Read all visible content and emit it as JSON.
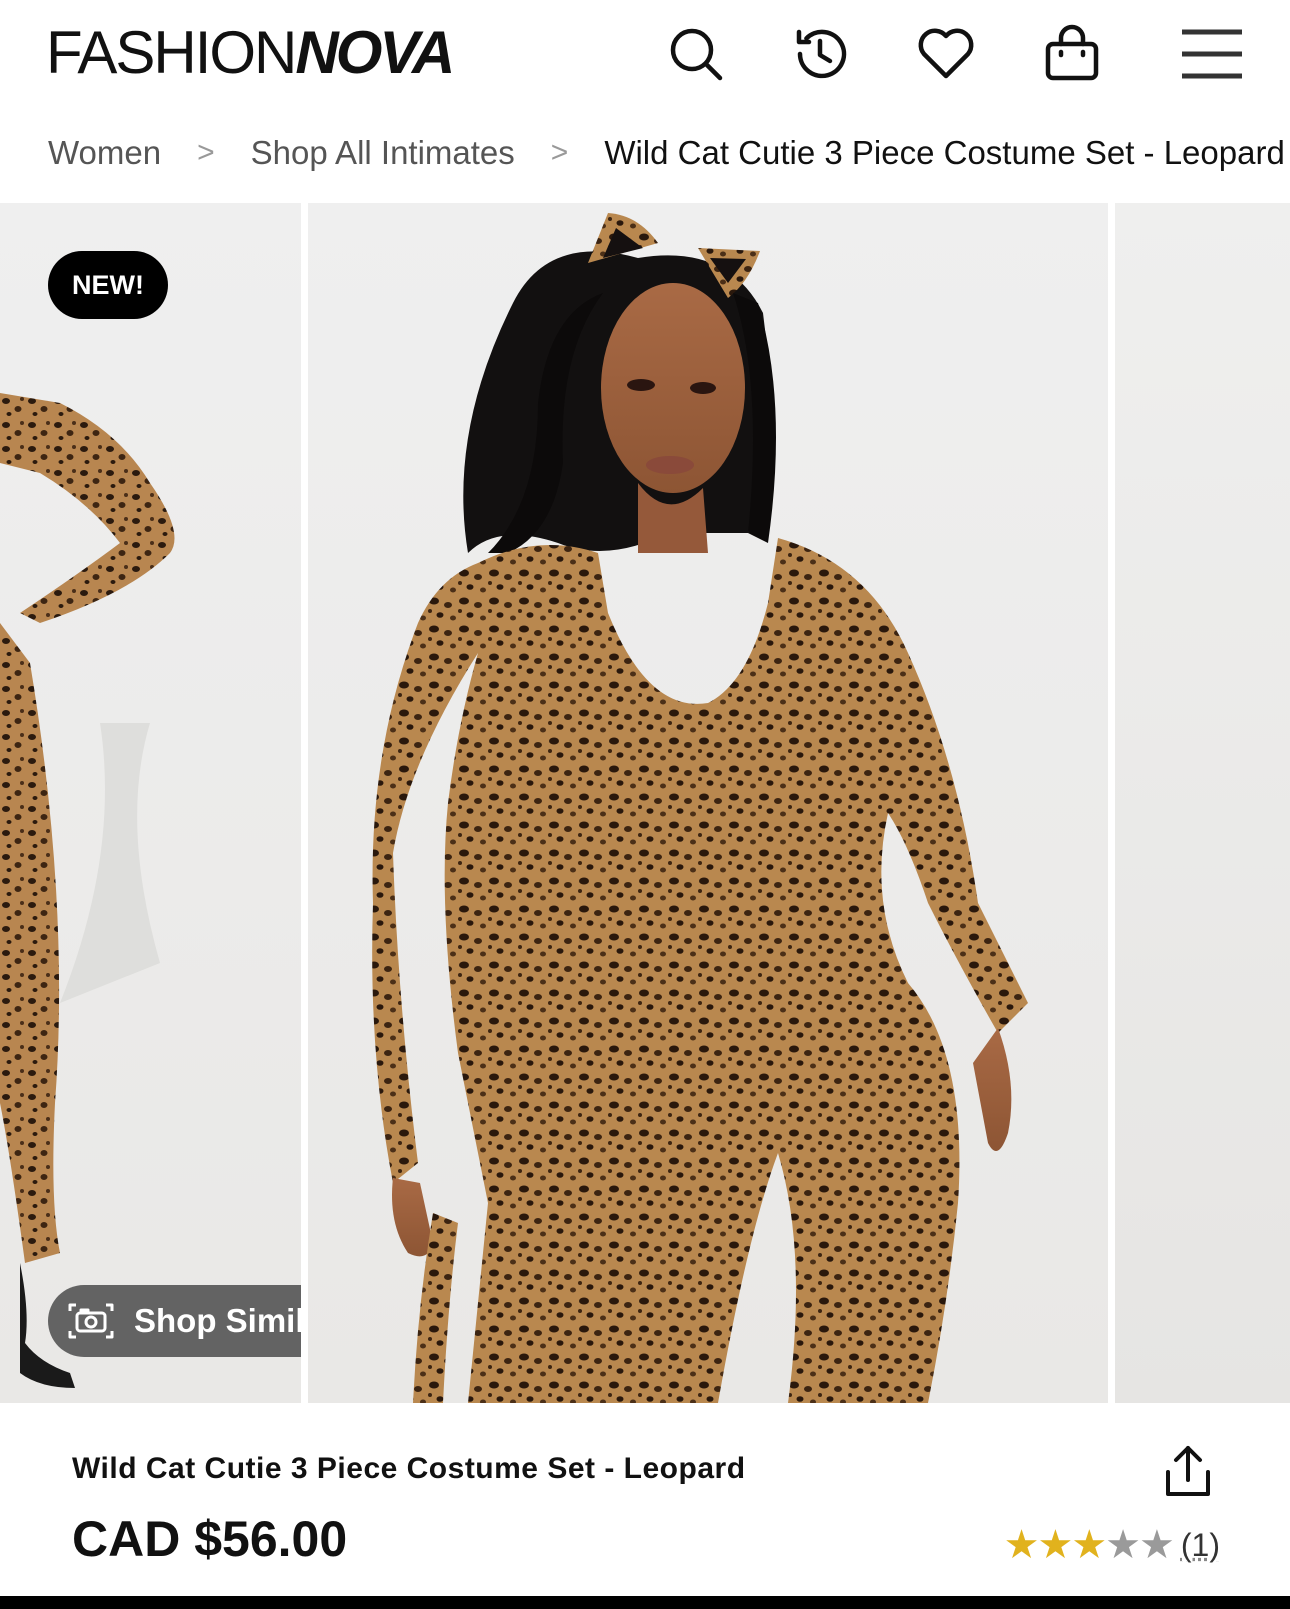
{
  "brand": {
    "logo_thin": "FASHION",
    "logo_bold": "NOVA"
  },
  "header": {
    "icons": [
      "search-icon",
      "history-icon",
      "heart-icon",
      "bag-icon",
      "menu-icon"
    ]
  },
  "breadcrumb": {
    "items": [
      "Women",
      "Shop All Intimates",
      "Wild Cat Cutie 3 Piece Costume Set - Leopard"
    ],
    "separator": ">"
  },
  "gallery": {
    "badge": "NEW!",
    "shop_similar_label": "Shop Similar"
  },
  "product": {
    "title": "Wild Cat Cutie 3 Piece Costume Set - Leopard",
    "price": "CAD $56.00",
    "rating": {
      "stars_filled": 3,
      "stars_total": 5,
      "count": "(1)"
    }
  },
  "colors": {
    "star": "#e1b21d",
    "badge_bg": "#000000"
  }
}
